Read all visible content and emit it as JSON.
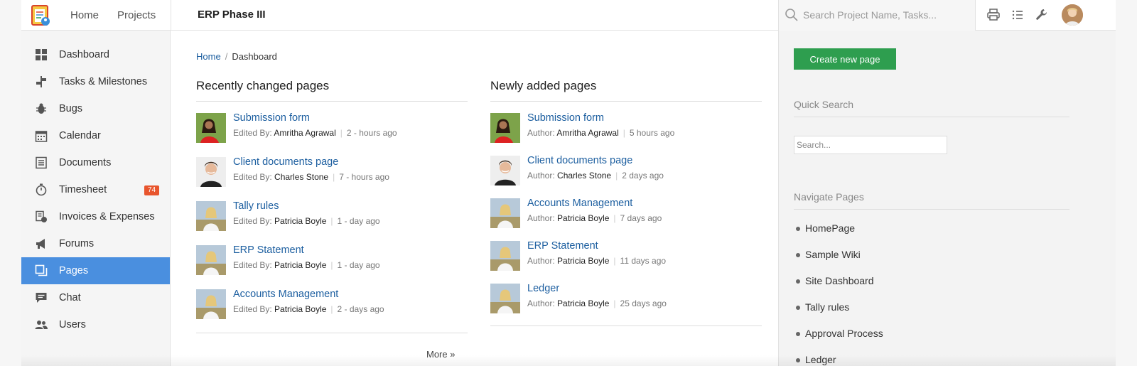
{
  "topnav": {
    "home_label": "Home",
    "projects_label": "Projects",
    "project_title": "ERP Phase III",
    "search_placeholder": "Search Project Name, Tasks..."
  },
  "sidebar": {
    "items": [
      {
        "label": "Dashboard",
        "icon": "dashboard-icon"
      },
      {
        "label": "Tasks & Milestones",
        "icon": "milestone-icon"
      },
      {
        "label": "Bugs",
        "icon": "bug-icon"
      },
      {
        "label": "Calendar",
        "icon": "calendar-icon"
      },
      {
        "label": "Documents",
        "icon": "document-icon"
      },
      {
        "label": "Timesheet",
        "icon": "stopwatch-icon",
        "badge": "74"
      },
      {
        "label": "Invoices & Expenses",
        "icon": "invoice-icon"
      },
      {
        "label": "Forums",
        "icon": "megaphone-icon"
      },
      {
        "label": "Pages",
        "icon": "pages-icon",
        "active": true
      },
      {
        "label": "Chat",
        "icon": "chat-icon"
      },
      {
        "label": "Users",
        "icon": "users-icon"
      }
    ]
  },
  "breadcrumb": {
    "home": "Home",
    "sep": "/",
    "current": "Dashboard"
  },
  "recent": {
    "heading": "Recently changed pages",
    "meta_label": "Edited By:",
    "items": [
      {
        "title": "Submission form",
        "by": "Amritha Agrawal",
        "when": "2 - hours ago",
        "avatar": "woman-dark"
      },
      {
        "title": "Client documents page",
        "by": "Charles Stone",
        "when": "7 - hours ago",
        "avatar": "man"
      },
      {
        "title": "Tally rules",
        "by": "Patricia Boyle",
        "when": "1 - day ago",
        "avatar": "woman-blonde"
      },
      {
        "title": "ERP Statement",
        "by": "Patricia Boyle",
        "when": "1 - day ago",
        "avatar": "woman-blonde"
      },
      {
        "title": "Accounts Management",
        "by": "Patricia Boyle",
        "when": "2 - days ago",
        "avatar": "woman-blonde"
      }
    ],
    "more_label": "More »"
  },
  "newly": {
    "heading": "Newly added pages",
    "meta_label": "Author:",
    "items": [
      {
        "title": "Submission form",
        "by": "Amritha Agrawal",
        "when": "5 hours ago",
        "avatar": "woman-dark"
      },
      {
        "title": "Client documents page",
        "by": "Charles Stone",
        "when": "2 days ago",
        "avatar": "man"
      },
      {
        "title": "Accounts Management",
        "by": "Patricia Boyle",
        "when": "7 days ago",
        "avatar": "woman-blonde"
      },
      {
        "title": "ERP Statement",
        "by": "Patricia Boyle",
        "when": "11 days ago",
        "avatar": "woman-blonde"
      },
      {
        "title": "Ledger",
        "by": "Patricia Boyle",
        "when": "25 days ago",
        "avatar": "woman-blonde"
      }
    ]
  },
  "rpanel": {
    "create_label": "Create new page",
    "quick_search_heading": "Quick Search",
    "quick_search_placeholder": "Search...",
    "navigate_heading": "Navigate Pages",
    "nav_items": [
      "HomePage",
      "Sample Wiki",
      "Site Dashboard",
      "Tally rules",
      "Approval Process",
      "Ledger"
    ]
  },
  "colors": {
    "accent": "#4a8fdf",
    "link": "#1d5fa0",
    "create_button": "#2e9e4f",
    "badge": "#e8552d"
  }
}
